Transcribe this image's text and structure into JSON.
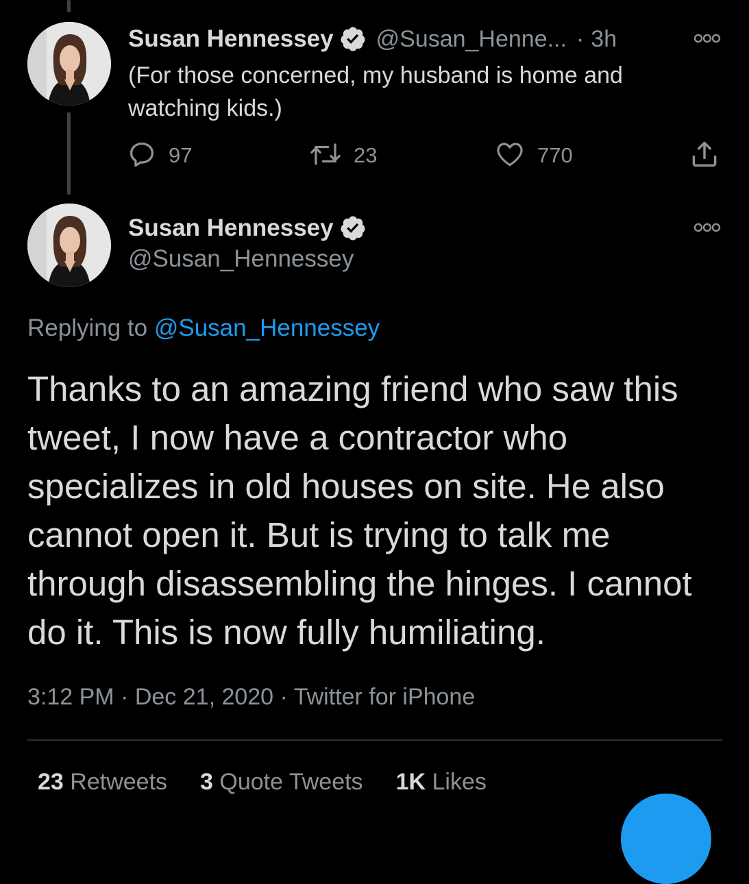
{
  "colors": {
    "background": "#000000",
    "primary_text": "#d9d9d9",
    "secondary_text": "#8b9298",
    "accent": "#1d9bf0",
    "divider": "#2f3336"
  },
  "tweet1": {
    "display_name": "Susan Hennessey",
    "verified_icon": "verified-badge-icon",
    "handle": "@Susan_Henne...",
    "separator": "·",
    "time": "3h",
    "text": "(For those concerned, my husband is home and watching kids.)",
    "actions": {
      "reply_count": "97",
      "retweet_count": "23",
      "like_count": "770"
    }
  },
  "tweet2": {
    "display_name": "Susan Hennessey",
    "handle": "@Susan_Hennessey",
    "replying_prefix": "Replying to",
    "replying_handle": "@Susan_Hennessey",
    "text": "Thanks to an amazing friend who saw this tweet, I now have a contractor who specializes in old houses on site. He also cannot open it. But is trying to talk me through disassembling the hinges. I cannot do it. This is now fully humiliating.",
    "meta": "3:12 PM · Dec 21, 2020 · Twitter for iPhone",
    "stats": {
      "retweets_count": "23",
      "retweets_label": "Retweets",
      "quotes_count": "3",
      "quotes_label": "Quote Tweets",
      "likes_count": "1K",
      "likes_label": "Likes"
    }
  }
}
